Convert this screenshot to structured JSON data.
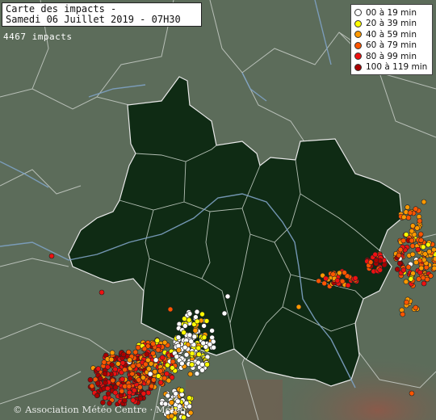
{
  "header": {
    "title_line1": "Carte des impacts -",
    "title_line2": "Samedi 06 Juillet 2019 - 07H30",
    "impact_count": "4467 impacts"
  },
  "legend": [
    {
      "label": "00 à 19 min",
      "color": "#ffffff"
    },
    {
      "label": "20 à 39 min",
      "color": "#ffff00"
    },
    {
      "label": "40 à 59 min",
      "color": "#ff9900"
    },
    {
      "label": "60 à 79 min",
      "color": "#ff5500"
    },
    {
      "label": "80 à 99 min",
      "color": "#ee1111"
    },
    {
      "label": "100 à 119 min",
      "color": "#aa0000"
    }
  ],
  "credit": "© Association Météo Centre · Météo",
  "colors": {
    "land": "#5b6b5b",
    "highlight_region": "#0f2a14",
    "borders": "#d8d8d8",
    "rivers": "#7fa4c8"
  }
}
